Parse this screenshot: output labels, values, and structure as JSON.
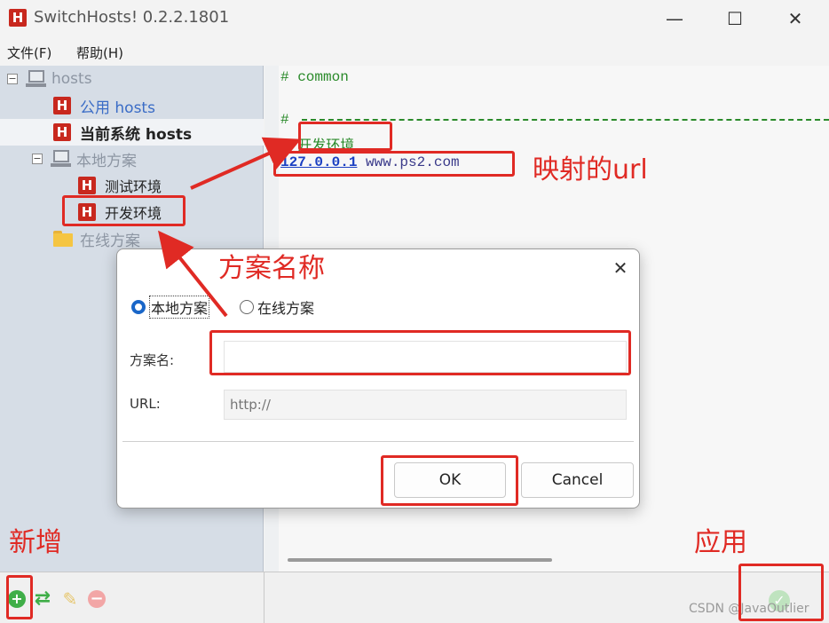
{
  "window": {
    "title": "SwitchHosts! 0.2.2.1801",
    "logo_letter": "H",
    "minimize": "—",
    "maximize": "☐",
    "close": "✕"
  },
  "menu": {
    "file": "文件(F)",
    "help": "帮助(H)"
  },
  "sidebar": {
    "items": [
      {
        "label": "hosts",
        "icon": "computer-icon",
        "level": 0,
        "style": "gray"
      },
      {
        "label": "公用 hosts",
        "icon": "hosts-h-icon",
        "level": 1,
        "style": "blue"
      },
      {
        "label": "当前系统 hosts",
        "icon": "hosts-h-icon",
        "level": 1,
        "style": "bold",
        "selected": true
      },
      {
        "label": "本地方案",
        "icon": "computer-icon",
        "level": 1,
        "style": "gray"
      },
      {
        "label": "测试环境",
        "icon": "hosts-h-icon",
        "level": 2,
        "style": "dark"
      },
      {
        "label": "开发环境",
        "icon": "hosts-h-icon",
        "level": 2,
        "style": "dark"
      },
      {
        "label": "在线方案",
        "icon": "folder-icon",
        "level": 1,
        "style": "gray"
      }
    ]
  },
  "editor": {
    "line1": "# common",
    "line2": "#",
    "line3_prefix": "# ",
    "line3_text": "开发环境",
    "line4_ip": "127.0.0.1",
    "line4_domain": " www.ps2.com"
  },
  "dialog": {
    "close": "✕",
    "radio_local": "本地方案",
    "radio_online": "在线方案",
    "selected_radio": "local",
    "name_label": "方案名:",
    "name_value": "",
    "url_label": "URL:",
    "url_placeholder": "http://",
    "ok": "OK",
    "cancel": "Cancel"
  },
  "toolbar": {
    "add": "+",
    "refresh": "⇄",
    "edit": "✎",
    "delete": "−",
    "apply": "✓"
  },
  "annotations": {
    "mapping_url": "映射的url",
    "scheme_name": "方案名称",
    "add_new": "新增",
    "apply": "应用",
    "color": "#e02a24"
  },
  "watermark": "CSDN @JavaOutlier"
}
